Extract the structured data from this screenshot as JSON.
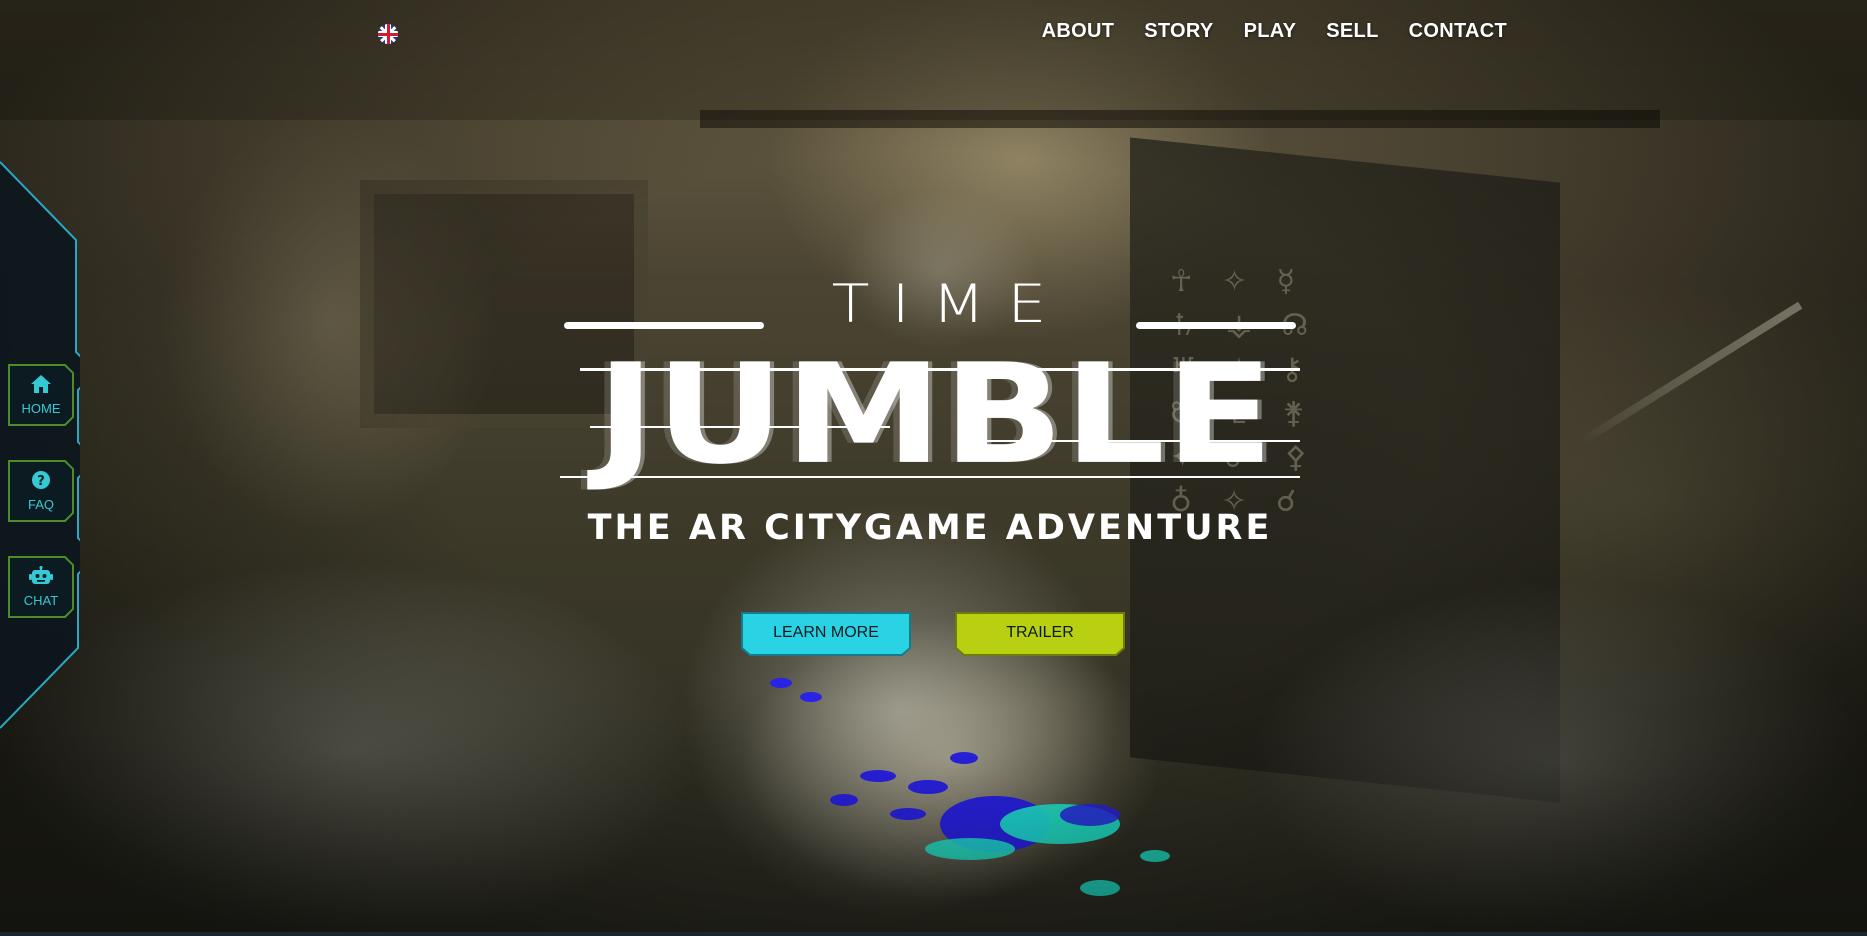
{
  "nav": {
    "language_icon": "uk-flag-icon",
    "items": [
      "ABOUT",
      "STORY",
      "PLAY",
      "SELL",
      "CONTACT"
    ]
  },
  "sidebar": {
    "items": [
      {
        "label": "HOME",
        "icon": "home-icon"
      },
      {
        "label": "FAQ",
        "icon": "question-icon"
      },
      {
        "label": "CHAT",
        "icon": "robot-icon"
      }
    ]
  },
  "hero": {
    "title_top": "TIME",
    "title_main": "JUMBLE",
    "tagline": "THE AR CITYGAME ADVENTURE"
  },
  "cta": {
    "learn_more": "LEARN MORE",
    "trailer": "TRAILER"
  },
  "colors": {
    "accent_cyan": "#2ad3e3",
    "accent_lime": "#b9cf12",
    "sidebar_bg": "#0e1c24",
    "sidebar_border": "#2aa7c4"
  }
}
